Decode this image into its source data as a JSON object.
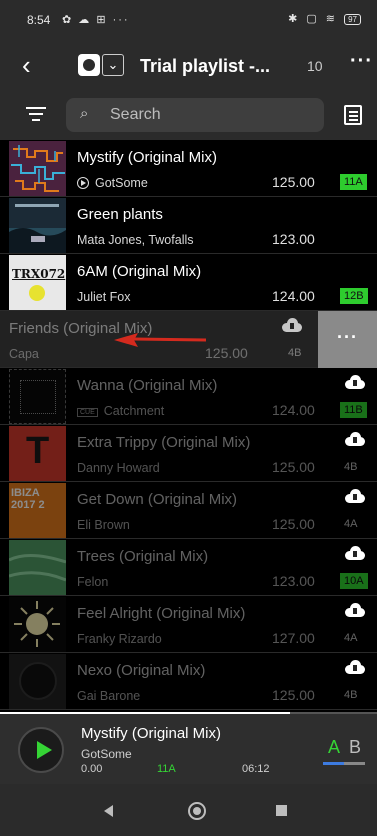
{
  "status_bar": {
    "time": "8:54",
    "left_icons": "✿ ☁ ⊞ ···",
    "right_icons": "✱ ▢ ≋",
    "battery": "97"
  },
  "header": {
    "back_icon": "back-arrow-icon",
    "title": "Trial playlist -...",
    "count": "10",
    "more_icon": "more-dots-icon",
    "more_label": "···",
    "chevron": "⌄"
  },
  "search": {
    "placeholder": "Search",
    "search_icon": "⌕"
  },
  "tracks": [
    {
      "title": "Mystify (Original Mix)",
      "artist": "GotSome",
      "bpm": "125.00",
      "key": "11A",
      "key_color": "#2ecc2e"
    },
    {
      "title": "Green plants",
      "artist": "Mata Jones, Twofalls",
      "bpm": "123.00",
      "key": ""
    },
    {
      "title": "6AM (Original Mix)",
      "artist": "Juliet Fox",
      "bpm": "124.00",
      "key": "12B",
      "key_color": "#2ecc2e",
      "art_text": "TRX072"
    },
    {
      "title": "Friends  (Original Mix)",
      "artist": "Capa",
      "bpm": "125.00",
      "key": "4B",
      "swipe_action": "···"
    },
    {
      "title": "Wanna (Original Mix)",
      "artist": "Catchment",
      "bpm": "124.00",
      "key": "11B",
      "key_color": "#2ecc2e",
      "tag": "CUE"
    },
    {
      "title": "Extra Trippy (Original Mix)",
      "artist": "Danny Howard",
      "bpm": "125.00",
      "key": "4B",
      "art_text": "T"
    },
    {
      "title": "Get Down (Original Mix)",
      "artist": "Eli Brown",
      "bpm": "125.00",
      "key": "4A",
      "art_text": "IBIZA 2017 2"
    },
    {
      "title": "Trees (Original Mix)",
      "artist": "Felon",
      "bpm": "123.00",
      "key": "10A",
      "key_color": "#2ecc2e"
    },
    {
      "title": "Feel Alright (Original Mix)",
      "artist": "Franky Rizardo",
      "bpm": "127.00",
      "key": "4A"
    },
    {
      "title": "Nexo (Original Mix)",
      "artist": "Gai Barone",
      "bpm": "125.00",
      "key": "4B"
    }
  ],
  "player": {
    "title": "Mystify (Original Mix)",
    "artist": "GotSome",
    "position": "0.00",
    "key": "11A",
    "duration": "06:12",
    "deck_a": "A",
    "deck_b": "B",
    "accent": "#35d435"
  }
}
